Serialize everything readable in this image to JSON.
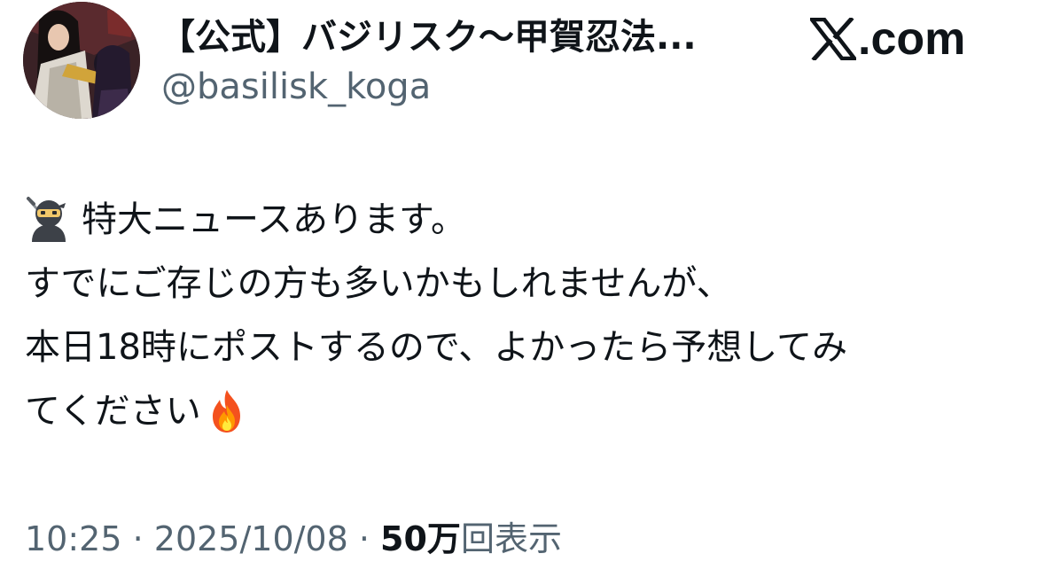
{
  "account": {
    "display_name": "【公式】バジリスク〜甲賀忍法...",
    "handle": "@basilisk_koga",
    "avatar_icon": "anime-avatar"
  },
  "branding": {
    "site_label": ".com",
    "logo_icon": "x-logo-icon"
  },
  "tweet": {
    "lines": [
      {
        "emoji": "ninja-emoji",
        "text": "特大ニュースあります。"
      },
      {
        "text": "すでにご存じの方も多いかもしれませんが、"
      },
      {
        "text": "本日18時にポストするので、よかったら予想してみ"
      },
      {
        "text": "てください",
        "emoji_after": "fire-emoji"
      }
    ]
  },
  "meta": {
    "time": "10:25",
    "separator": " · ",
    "date": "2025/10/08",
    "views_count": "50万",
    "views_label": "回表示"
  },
  "colors": {
    "text_primary": "#0f1419",
    "text_secondary": "#536471",
    "background": "#ffffff"
  }
}
